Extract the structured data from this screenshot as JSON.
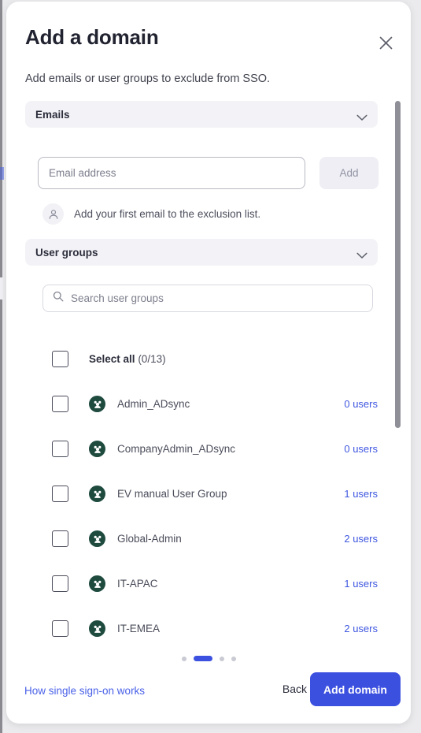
{
  "modal": {
    "title": "Add a domain",
    "subtitle": "Add emails or user groups to exclude from SSO.",
    "close_icon": "close-icon"
  },
  "emails_section": {
    "header_label": "Emails",
    "chevron_icon": "chevron-down-icon",
    "input_placeholder": "Email address",
    "input_value": "",
    "add_label": "Add",
    "empty_icon": "user-avatar-icon",
    "empty_text": "Add your first email to the exclusion list."
  },
  "groups_section": {
    "header_label": "User groups",
    "chevron_icon": "chevron-down-icon",
    "search_icon": "search-icon",
    "search_placeholder": "Search user groups",
    "search_value": "",
    "select_all_label": "Select all",
    "select_all_count": "(0/13)",
    "group_icon": "user-group-icon",
    "rows": [
      {
        "name": "Admin_ADsync",
        "users": "0 users"
      },
      {
        "name": "CompanyAdmin_ADsync",
        "users": "0 users"
      },
      {
        "name": "EV manual User Group",
        "users": "1 users"
      },
      {
        "name": "Global-Admin",
        "users": "2 users"
      },
      {
        "name": "IT-APAC",
        "users": "1 users"
      },
      {
        "name": "IT-EMEA",
        "users": "2 users"
      }
    ]
  },
  "pagination": {
    "total": 4,
    "active_index": 1
  },
  "footer": {
    "help_link": "How single sign-on works",
    "back_label": "Back",
    "submit_label": "Add domain"
  },
  "colors": {
    "accent": "#3c50e0",
    "link": "#4a61e8",
    "group_icon_bg": "#1f4b3f",
    "section_bg": "#f3f3f7",
    "scrollbar": "#8e8f97"
  }
}
